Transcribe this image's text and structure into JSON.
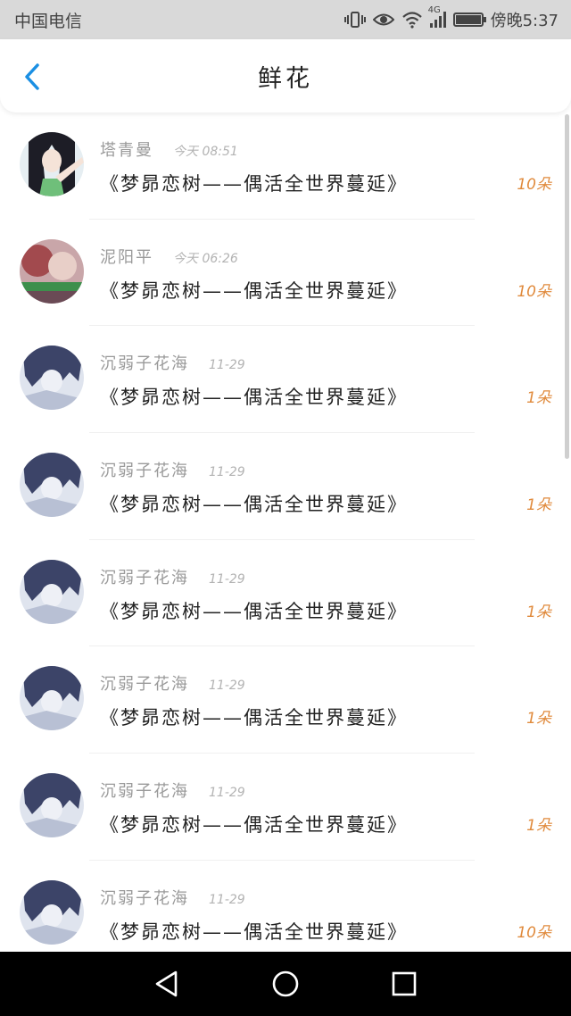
{
  "status_bar": {
    "carrier": "中国电信",
    "network": "4G",
    "time": "傍晚5:37",
    "battery_level": 0.95
  },
  "header": {
    "title": "鲜花",
    "back_icon": "chevron-left-icon"
  },
  "colors": {
    "accent": "#1a8fe3",
    "count": "#e08a3c",
    "name": "#9a9a9a"
  },
  "list": [
    {
      "name": "塔青曼",
      "time": "今天 08:51",
      "book": "《梦昴恋树——偶活全世界蔓延》",
      "count": "10朵",
      "avatar": "avatar-girl-green"
    },
    {
      "name": "泥阳平",
      "time": "今天 06:26",
      "book": "《梦昴恋树——偶活全世界蔓延》",
      "count": "10朵",
      "avatar": "avatar-pink"
    },
    {
      "name": "沉弱子花海",
      "time": "11-29",
      "book": "《梦昴恋树——偶活全世界蔓延》",
      "count": "1朵",
      "avatar": "avatar-blue"
    },
    {
      "name": "沉弱子花海",
      "time": "11-29",
      "book": "《梦昴恋树——偶活全世界蔓延》",
      "count": "1朵",
      "avatar": "avatar-blue"
    },
    {
      "name": "沉弱子花海",
      "time": "11-29",
      "book": "《梦昴恋树——偶活全世界蔓延》",
      "count": "1朵",
      "avatar": "avatar-blue"
    },
    {
      "name": "沉弱子花海",
      "time": "11-29",
      "book": "《梦昴恋树——偶活全世界蔓延》",
      "count": "1朵",
      "avatar": "avatar-blue"
    },
    {
      "name": "沉弱子花海",
      "time": "11-29",
      "book": "《梦昴恋树——偶活全世界蔓延》",
      "count": "1朵",
      "avatar": "avatar-blue"
    },
    {
      "name": "沉弱子花海",
      "time": "11-29",
      "book": "《梦昴恋树——偶活全世界蔓延》",
      "count": "10朵",
      "avatar": "avatar-blue"
    }
  ],
  "nav_bar": {
    "back": "nav-back-icon",
    "home": "nav-home-icon",
    "recents": "nav-recents-icon"
  }
}
